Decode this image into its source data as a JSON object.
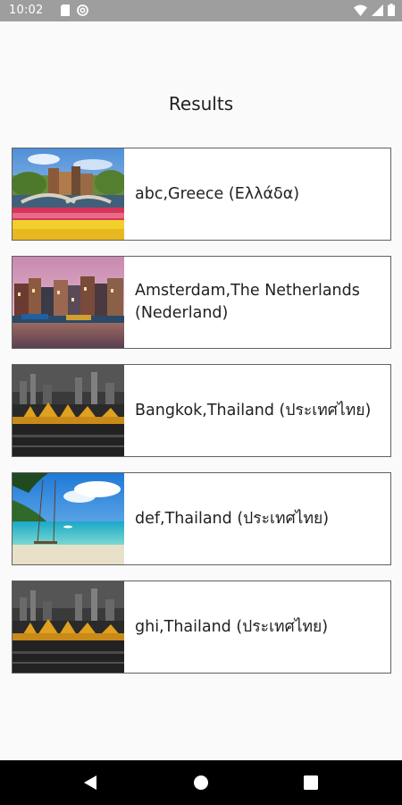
{
  "status_bar": {
    "time": "10:02",
    "left_icons": [
      "sd-card-icon",
      "at-sign-icon"
    ],
    "right_icons": [
      "wifi-icon",
      "cellular-signal-icon",
      "battery-icon"
    ]
  },
  "page": {
    "title": "Results"
  },
  "results": [
    {
      "label": "abc,Greece (Ελλάδα)",
      "image": "tulip-field-bridge-photo"
    },
    {
      "label": "Amsterdam,The Netherlands (Nederland)",
      "image": "amsterdam-canal-houses-photo"
    },
    {
      "label": "Bangkok,Thailand (ประเทศไทย)",
      "image": "bangkok-night-skyline-photo"
    },
    {
      "label": "def,Thailand (ประเทศไทย)",
      "image": "tropical-beach-swing-photo"
    },
    {
      "label": "ghi,Thailand (ประเทศไทย)",
      "image": "bangkok-night-skyline-photo"
    }
  ],
  "nav_bar": {
    "buttons": [
      "back-button",
      "home-button",
      "recents-button"
    ]
  },
  "colors": {
    "status_bar_bg": "#9e9e9e",
    "page_bg": "#fafafa",
    "card_border": "#616161",
    "nav_bar_bg": "#000000"
  }
}
